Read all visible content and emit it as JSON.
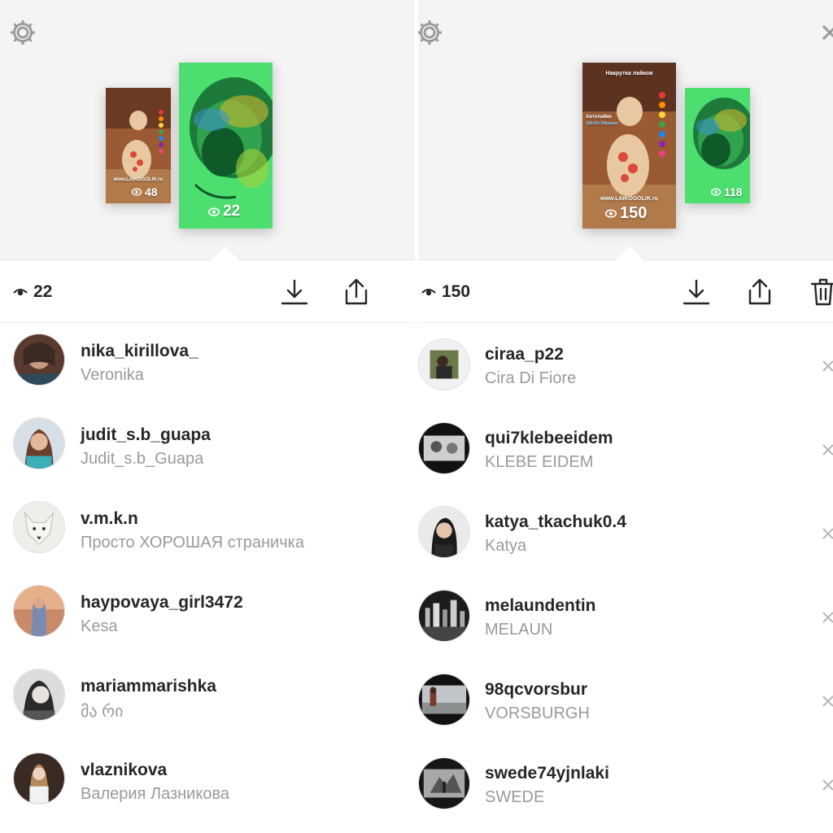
{
  "colors": {
    "accent_green": "#4cde6e",
    "text_primary": "#262626",
    "text_secondary": "#9a9a9a",
    "preview_bg": "#f4f4f4"
  },
  "left": {
    "thumbs": {
      "small": {
        "views": "48",
        "url_text": "www.LAIKOGOLIK.ru"
      },
      "large": {
        "views": "22"
      }
    },
    "view_count": "22",
    "icons": [
      "eye-icon",
      "download-icon",
      "share-icon",
      "gear-icon"
    ],
    "viewers": [
      {
        "username": "nika_kirillova_",
        "fullname": "Veronika"
      },
      {
        "username": "judit_s.b_guapa",
        "fullname": "Judit_s.b_Guapa"
      },
      {
        "username": "v.m.k.n",
        "fullname": "Просто ХОРОШАЯ страничка"
      },
      {
        "username": "haypovaya_girl3472",
        "fullname": "Kesa"
      },
      {
        "username": "mariammarishka",
        "fullname": "მა რი"
      },
      {
        "username": "vlaznikova",
        "fullname": "Валерия Лазникова"
      }
    ]
  },
  "right": {
    "thumbs": {
      "large": {
        "views": "150",
        "title": "Накрутка лайков",
        "subtitle": "Автолайки",
        "subtitle2": "100/10+390р/мес",
        "url_text": "www.LAIKOGOLIK.ru"
      },
      "small": {
        "views": "118"
      }
    },
    "view_count": "150",
    "icons": [
      "eye-icon",
      "download-icon",
      "share-icon",
      "trash-icon",
      "gear-icon",
      "close-icon",
      "remove-viewer-icon"
    ],
    "viewers": [
      {
        "username": "ciraa_p22",
        "fullname": "Cira Di Fiore"
      },
      {
        "username": "qui7klebeeidem",
        "fullname": "KLEBE EIDEM"
      },
      {
        "username": "katya_tkachuk0.4",
        "fullname": "Katya"
      },
      {
        "username": "melaundentin",
        "fullname": "MELAUN"
      },
      {
        "username": "98qcvorsbur",
        "fullname": "VORSBURGH"
      },
      {
        "username": "swede74yjnlaki",
        "fullname": "SWEDE"
      }
    ]
  }
}
